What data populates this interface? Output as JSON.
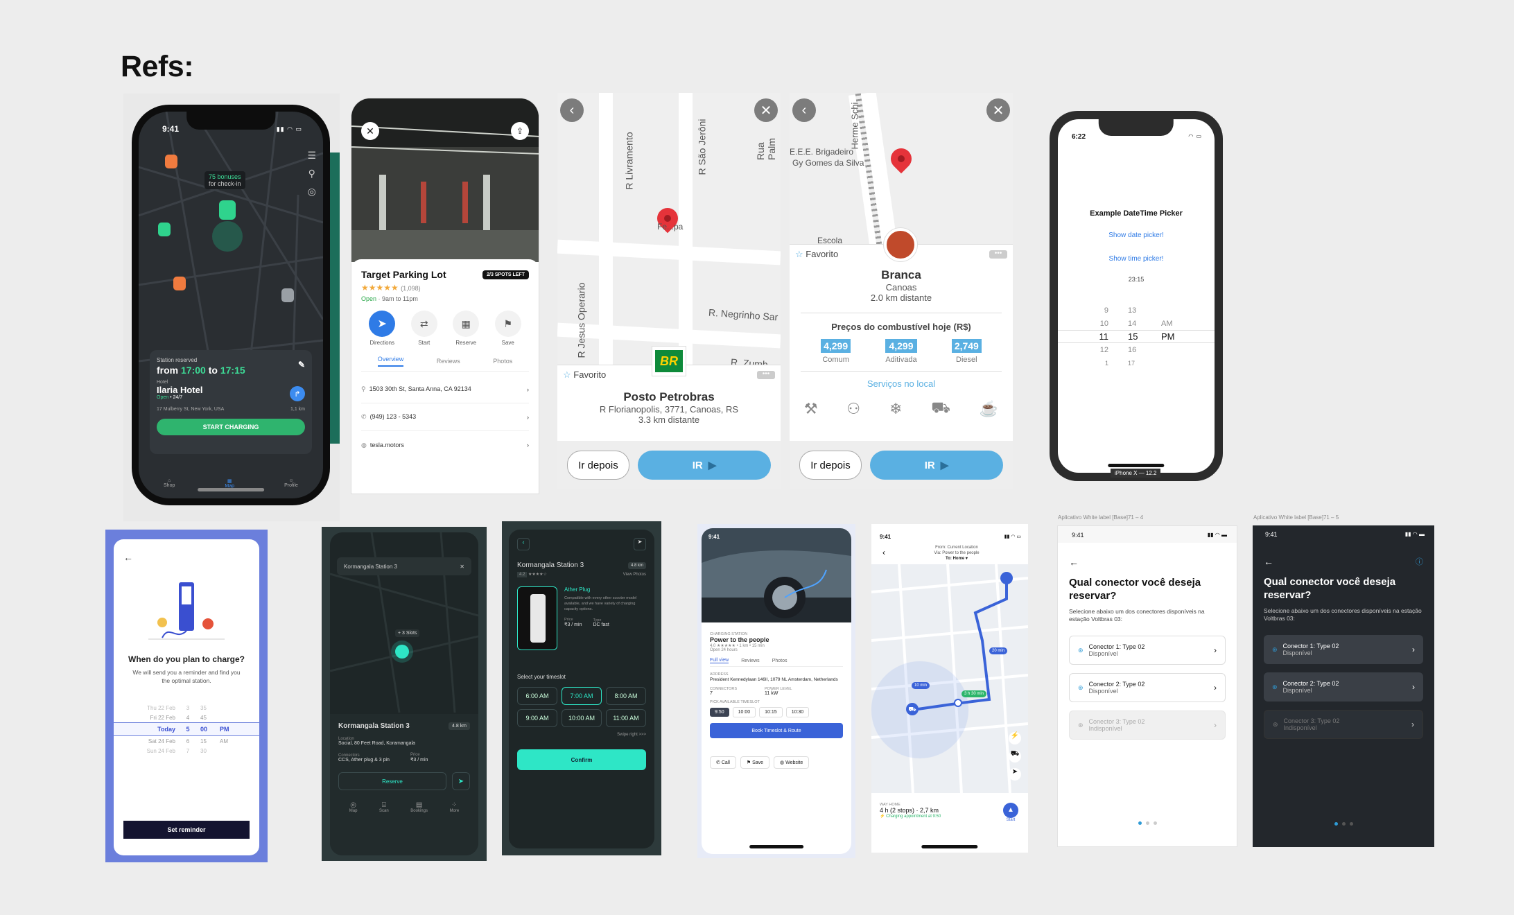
{
  "title": "Refs:",
  "c1": {
    "time": "9:41",
    "bonus": "75 bonuses",
    "bonus2": "for check-in",
    "reserved": "Station reserved",
    "from": "from",
    "t1": "17:00",
    "to": "to",
    "t2": "17:15",
    "hotel_lbl": "Hotel",
    "hotel": "Ilaria Hotel",
    "open": "Open",
    "hours": "• 24/7",
    "addr": "17 Mulberry St, New York, USA",
    "dist": "1,1 km",
    "cta": "START CHARGING",
    "nav": [
      "Shop",
      "Map",
      "Profile"
    ]
  },
  "c2": {
    "name": "Target Parking Lot",
    "badge": "2/3 SPOTS LEFT",
    "stars": "★★★★★",
    "reviews": "(1,098)",
    "open": "Open",
    "hours": "· 9am to 11pm",
    "actions": [
      "Directions",
      "Start",
      "Reserve",
      "Save"
    ],
    "tabs": [
      "Overview",
      "Reviews",
      "Photos"
    ],
    "rows": [
      "1503 30th St, Santa Anna, CA 92134",
      "(949) 123 - 5343",
      "tesla.motors"
    ]
  },
  "c3": {
    "streets": [
      "R Livramento",
      "R São Jerôni",
      "Rua Palm",
      "R Jesus Operario",
      "R. Negrinho Sar",
      "R. Zumb"
    ],
    "pinlabel": "Fe...pa",
    "fav": "Favorito",
    "name": "Posto Petrobras",
    "addr": "R Florianopolis, 3771, Canoas, RS",
    "dist": "3.3 km distante",
    "later": "Ir depois",
    "go": "IR",
    "logo": "BR"
  },
  "c4": {
    "streets": [
      "Herme Schi",
      "E.E.E. Brigadeiro",
      "Gy Gomes da Silva",
      "Escola"
    ],
    "fav": "Favorito",
    "name": "Branca",
    "city": "Canoas",
    "dist": "2.0 km distante",
    "prices_title": "Preços do combustível hoje (R$)",
    "prices": [
      {
        "v": "4,299",
        "l": "Comum"
      },
      {
        "v": "4,299",
        "l": "Aditivada"
      },
      {
        "v": "2,749",
        "l": "Diesel"
      }
    ],
    "services": "Serviços no local",
    "later": "Ir depois",
    "go": "IR"
  },
  "c5": {
    "time": "6:22",
    "heading": "Example DateTime Picker",
    "date": "Show date picker!",
    "timep": "Show time picker!",
    "val": "23:15",
    "rows": [
      [
        "9",
        "13",
        ""
      ],
      [
        "10",
        "14",
        "AM"
      ],
      [
        "11",
        "15",
        "PM"
      ],
      [
        "12",
        "16",
        ""
      ],
      [
        "1",
        "17",
        ""
      ]
    ],
    "device": "iPhone X — 12.2"
  },
  "c6": {
    "q": "When do you plan to charge?",
    "sub": "We will send you a reminder and find you the optimal station.",
    "rows": [
      [
        "Thu 22 Feb",
        "3",
        "35",
        ""
      ],
      [
        "Fri 22 Feb",
        "4",
        "45",
        ""
      ],
      [
        "Today",
        "5",
        "00",
        "PM"
      ],
      [
        "Sat 24 Feb",
        "6",
        "15",
        "AM"
      ],
      [
        "Sun 24 Feb",
        "7",
        "30",
        ""
      ]
    ],
    "cta": "Set reminder"
  },
  "c7": {
    "search": "Kormangala Station 3",
    "slots": "+ 3 Slots",
    "name": "Kormangala Station 3",
    "dist": "4.8 km",
    "loc_lbl": "Location",
    "loc": "Social, 80 Feet Road, Koramangala",
    "con_lbl": "Connectors",
    "con": "CCS, Ather plug & 3 pin",
    "pr_lbl": "Price",
    "pr": "₹3 / min",
    "cta": "Reserve",
    "nav": [
      "Map",
      "Scan",
      "Bookings",
      "More"
    ]
  },
  "c8": {
    "name": "Kormangala Station 3",
    "dist": "4.8 km",
    "rating": "4.2",
    "photos": "View Photos",
    "plug": "Ather Plug",
    "desc": "Compatible with every other scooter model available, and we have variety of charging capacity options.",
    "price_lbl": "Price",
    "price": "₹3 / min",
    "type_lbl": "Type",
    "type": "DC fast",
    "slot_title": "Select your timeslot",
    "slots": [
      "6:00 AM",
      "7:00 AM",
      "8:00 AM",
      "9:00 AM",
      "10:00 AM",
      "11:00 AM"
    ],
    "swipe": "Swipe right >>>",
    "cta": "Confirm"
  },
  "c9": {
    "time": "9:41",
    "lbl": "CHARGING STATION",
    "name": "Power to the people",
    "meta": "4.0 ★★★★★ • 1 km • 15 min",
    "open": "Open 24 hours",
    "tabs": [
      "Full view",
      "Reviews",
      "Photos"
    ],
    "addr_lbl": "ADDRESS",
    "addr": "President Kennedylaan 146II, 1079 NL Amsterdam, Netherlands",
    "con_lbl": "CONNECTORS",
    "con": "7",
    "pow_lbl": "POWER LEVEL",
    "pow": "11 kW",
    "pick": "PICK AVAILABLE TIMESLOT",
    "slots": [
      "9:50",
      "10:00",
      "10:15",
      "10:30"
    ],
    "cta": "Book Timeslot & Route",
    "acts": [
      "Call",
      "Save",
      "Website"
    ]
  },
  "c10": {
    "time": "9:41",
    "from": "From: Current Location",
    "via": "Via: Power to the people",
    "to": "To: Home ▾",
    "b1": "20 min",
    "b2": "10 min",
    "b3": "3 h 30 min",
    "way": "WAY HOME",
    "eta": "4 h (2 stops) · 2,7 km",
    "charge": "Charging appointment at 9:50",
    "start": "Start"
  },
  "c11": {
    "label": "Aplicativo White label [Base]71 – 4",
    "time": "9:41",
    "q": "Qual conector você deseja reservar?",
    "sub": "Selecione abaixo um dos conectores disponíveis na estação Voltbras 03:",
    "opts": [
      {
        "n": "Conector 1: Type 02",
        "s": "Disponível"
      },
      {
        "n": "Conector 2: Type 02",
        "s": "Disponível"
      },
      {
        "n": "Conector 3: Type 02",
        "s": "Indisponível"
      }
    ]
  },
  "c12": {
    "label": "Aplicativo White label [Base]71 – 5",
    "time": "9:41",
    "q": "Qual conector você deseja reservar?",
    "sub": "Selecione abaixo um dos conectores disponíveis na estação Voltbras 03:",
    "opts": [
      {
        "n": "Conector 1: Type 02",
        "s": "Disponível"
      },
      {
        "n": "Conector 2: Type 02",
        "s": "Disponível"
      },
      {
        "n": "Conector 3: Type 02",
        "s": "Indisponível"
      }
    ]
  }
}
